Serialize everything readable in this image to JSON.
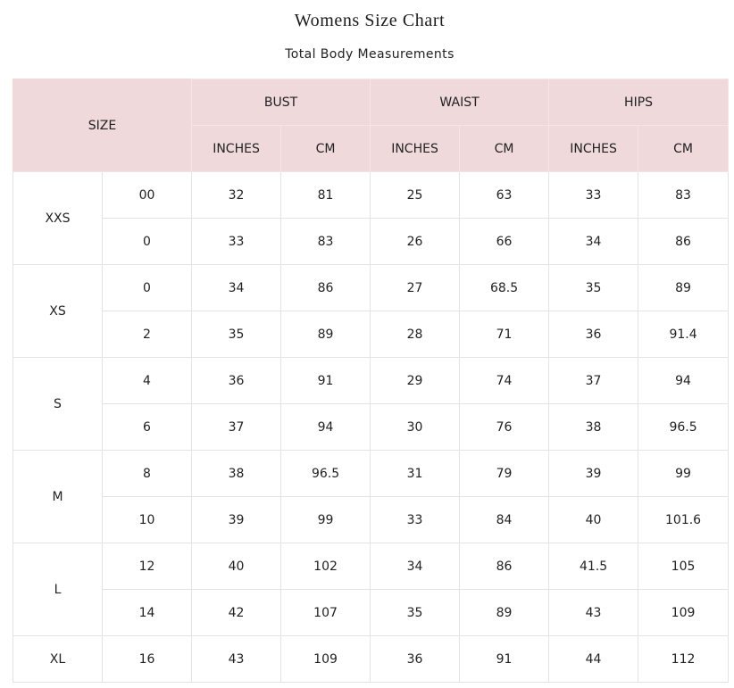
{
  "title": "Womens Size Chart",
  "subtitle": "Total Body Measurements",
  "header": {
    "size": "SIZE",
    "groups": [
      "BUST",
      "WAIST",
      "HIPS"
    ],
    "units": [
      "INCHES",
      "CM",
      "INCHES",
      "CM",
      "INCHES",
      "CM"
    ]
  },
  "colors": {
    "header_background": "#efd9da",
    "grid_line": "#e3e3e3"
  },
  "groups": [
    {
      "label": "XXS",
      "rows": [
        [
          "00",
          "32",
          "81",
          "25",
          "63",
          "33",
          "83"
        ],
        [
          "0",
          "33",
          "83",
          "26",
          "66",
          "34",
          "86"
        ]
      ]
    },
    {
      "label": "XS",
      "rows": [
        [
          "0",
          "34",
          "86",
          "27",
          "68.5",
          "35",
          "89"
        ],
        [
          "2",
          "35",
          "89",
          "28",
          "71",
          "36",
          "91.4"
        ]
      ]
    },
    {
      "label": "S",
      "rows": [
        [
          "4",
          "36",
          "91",
          "29",
          "74",
          "37",
          "94"
        ],
        [
          "6",
          "37",
          "94",
          "30",
          "76",
          "38",
          "96.5"
        ]
      ]
    },
    {
      "label": "M",
      "rows": [
        [
          "8",
          "38",
          "96.5",
          "31",
          "79",
          "39",
          "99"
        ],
        [
          "10",
          "39",
          "99",
          "33",
          "84",
          "40",
          "101.6"
        ]
      ]
    },
    {
      "label": "L",
      "rows": [
        [
          "12",
          "40",
          "102",
          "34",
          "86",
          "41.5",
          "105"
        ],
        [
          "14",
          "42",
          "107",
          "35",
          "89",
          "43",
          "109"
        ]
      ]
    },
    {
      "label": "XL",
      "rows": [
        [
          "16",
          "43",
          "109",
          "36",
          "91",
          "44",
          "112"
        ]
      ]
    }
  ]
}
